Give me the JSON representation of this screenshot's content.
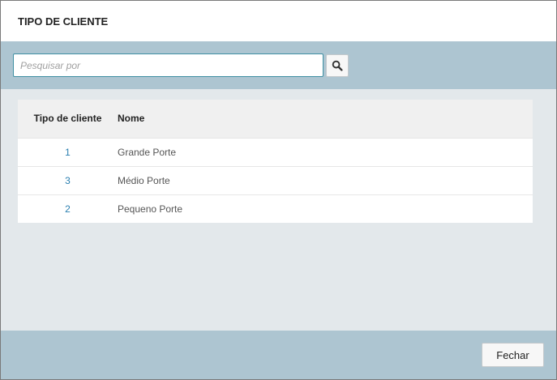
{
  "dialog": {
    "title": "TIPO DE CLIENTE"
  },
  "search": {
    "placeholder": "Pesquisar por",
    "value": "",
    "button_icon": "search-icon"
  },
  "table": {
    "headers": {
      "tipo": "Tipo de cliente",
      "nome": "Nome"
    },
    "rows": [
      {
        "tipo": "1",
        "nome": "Grande Porte"
      },
      {
        "tipo": "3",
        "nome": "Médio Porte"
      },
      {
        "tipo": "2",
        "nome": "Pequeno Porte"
      }
    ]
  },
  "footer": {
    "close_label": "Fechar"
  },
  "colors": {
    "header_bg": "#ffffff",
    "bar_bg": "#adc5d1",
    "content_bg": "#e3e8eb",
    "link": "#2a7fb0",
    "input_border": "#3f8fa3"
  }
}
